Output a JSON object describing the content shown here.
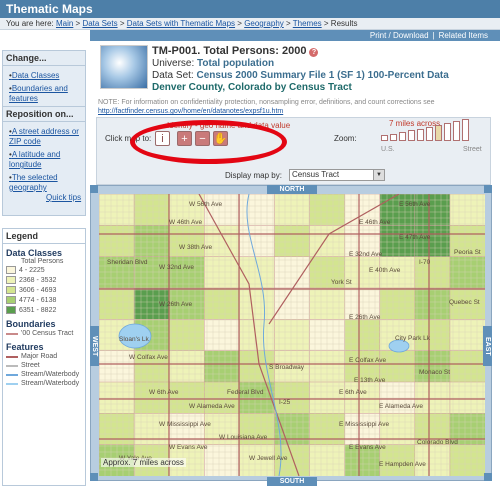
{
  "app": {
    "title": "Thematic Maps"
  },
  "breadcrumb": {
    "prefix": "You are here:",
    "items": [
      "Main",
      "Data Sets",
      "Data Sets with Thematic Maps",
      "Geography",
      "Themes"
    ],
    "current": "Results",
    "separator": " > "
  },
  "toplinks": {
    "print": "Print / Download",
    "related": "Related Items"
  },
  "change_box": {
    "title": "Change...",
    "items": [
      "Data Classes",
      "Boundaries and features"
    ]
  },
  "reposition_box": {
    "title": "Reposition on...",
    "items": [
      "A street address or ZIP code",
      "A latitude and longitude",
      "The selected geography"
    ],
    "quick_tips": "Quick tips"
  },
  "header": {
    "title": "TM-P001. Total Persons: 2000",
    "universe_label": "Universe:",
    "universe_value": "Total population",
    "dataset_label": "Data Set:",
    "dataset_value": "Census 2000 Summary File 1 (SF 1) 100-Percent Data",
    "geography": "Denver County, Colorado by Census Tract",
    "note": "NOTE: For information on confidentiality protection, nonsampling error, definitions, and count corrections see",
    "note_link": "http://factfinder.census.gov/home/en/datanotes/expsf1u.htm"
  },
  "controls": {
    "click_map_to": "Click map to:",
    "identify_note": "Identify - geo name and data value",
    "zoom_label": "Zoom:",
    "zoom_scale": "7 miles across",
    "zoom_left": "U.S.",
    "zoom_right": "Street",
    "display_by_label": "Display map by:",
    "display_by_value": "Census Tract"
  },
  "tools": [
    {
      "name": "identify-tool-button",
      "glyph": "i"
    },
    {
      "name": "zoom-in-tool-button",
      "glyph": "+"
    },
    {
      "name": "zoom-out-tool-button",
      "glyph": "−"
    },
    {
      "name": "pan-tool-button",
      "glyph": "✋"
    }
  ],
  "zoom_levels": [
    {
      "fill": 0.25
    },
    {
      "fill": 0.32
    },
    {
      "fill": 0.4
    },
    {
      "fill": 0.48
    },
    {
      "fill": 0.56
    },
    {
      "fill": 0.64
    },
    {
      "fill": 0.72,
      "selected": true
    },
    {
      "fill": 0.82
    },
    {
      "fill": 0.91
    },
    {
      "fill": 1.0
    }
  ],
  "legend": {
    "title": "Legend",
    "data_classes_title": "Data Classes",
    "data_classes_subtitle": "Total Persons",
    "classes": [
      {
        "label": "4 - 2225",
        "color": "#fbf6dc"
      },
      {
        "label": "2368 - 3532",
        "color": "#eef3b8"
      },
      {
        "label": "3606 - 4693",
        "color": "#d3e590"
      },
      {
        "label": "4774 - 6138",
        "color": "#a7cf72"
      },
      {
        "label": "6351 - 8822",
        "color": "#5a9e4e"
      }
    ],
    "boundaries_title": "Boundaries",
    "boundaries": [
      {
        "label": "'00 Census Tract",
        "color": "#c98a8a"
      }
    ],
    "features_title": "Features",
    "features": [
      {
        "label": "Major Road",
        "color": "#b06060"
      },
      {
        "label": "Street",
        "color": "#bbbbbb"
      },
      {
        "label": "Stream/Waterbody",
        "color": "#6fa8dc"
      },
      {
        "label": "Stream/Waterbody",
        "color": "#9fd0f0"
      }
    ]
  },
  "map": {
    "north": "NORTH",
    "south": "SOUTH",
    "east": "EAST",
    "west": "WEST",
    "scale_text": "Approx. 7 miles across",
    "labels": [
      "W 56th Ave",
      "E 56th Ave",
      "W 46th Ave",
      "E 46th Ave",
      "W 38th Ave",
      "E 32nd Ave",
      "W 32nd Ave",
      "W 26th Ave",
      "Sloan's Lk",
      "E 26th Ave",
      "W Colfax Ave",
      "E Colfax Ave",
      "City Park Lk",
      "E 13th Ave",
      "W 6th Ave",
      "E 6th Ave",
      "E Alameda Ave",
      "W Alameda Ave",
      "W Mississippi Ave",
      "E Mississippi Ave",
      "W Evans Ave",
      "E Evans Ave",
      "W Yale Ave",
      "W Jewell Ave",
      "Federal Blvd",
      "Sheridan Blvd",
      "York St",
      "Colorado Blvd",
      "Quebec St",
      "Monaco St",
      "Peoria St",
      "I-70",
      "I-25",
      "E 40th Ave",
      "E 47th Ave",
      "W Louisiana Ave",
      "S Broadway",
      "E Hampden Ave"
    ]
  }
}
